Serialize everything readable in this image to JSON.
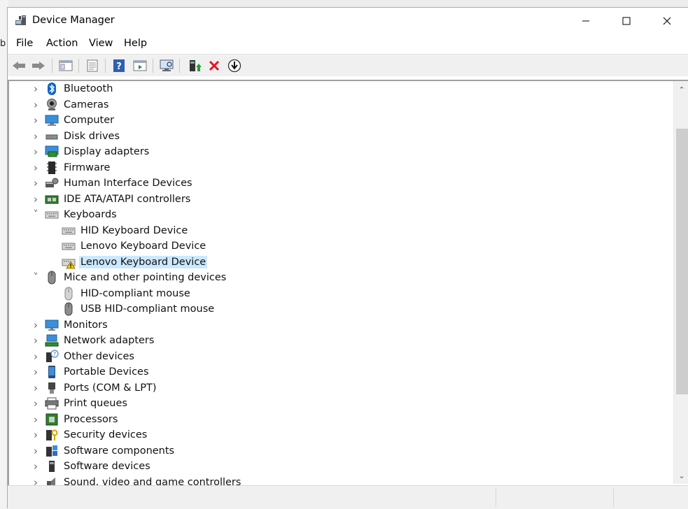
{
  "background": {
    "partial_text": "b"
  },
  "window": {
    "title": "Device Manager"
  },
  "menu": [
    "File",
    "Action",
    "View",
    "Help"
  ],
  "toolbar": [
    "back-arrow-icon",
    "forward-arrow-icon",
    "console-tree-icon",
    "properties-icon",
    "help-icon",
    "action-pane-icon",
    "scan-hardware-icon",
    "update-driver-icon",
    "uninstall-device-icon",
    "disable-device-icon"
  ],
  "tree": {
    "nodes": [
      {
        "label": "Bluetooth",
        "icon": "bluetooth-icon",
        "level": 0,
        "expander": "collapsed"
      },
      {
        "label": "Cameras",
        "icon": "camera-icon",
        "level": 0,
        "expander": "collapsed"
      },
      {
        "label": "Computer",
        "icon": "computer-icon",
        "level": 0,
        "expander": "collapsed"
      },
      {
        "label": "Disk drives",
        "icon": "disk-drive-icon",
        "level": 0,
        "expander": "collapsed"
      },
      {
        "label": "Display adapters",
        "icon": "display-adapter-icon",
        "level": 0,
        "expander": "collapsed"
      },
      {
        "label": "Firmware",
        "icon": "firmware-icon",
        "level": 0,
        "expander": "collapsed"
      },
      {
        "label": "Human Interface Devices",
        "icon": "hid-icon",
        "level": 0,
        "expander": "collapsed"
      },
      {
        "label": "IDE ATA/ATAPI controllers",
        "icon": "ide-controller-icon",
        "level": 0,
        "expander": "collapsed"
      },
      {
        "label": "Keyboards",
        "icon": "keyboard-icon",
        "level": 0,
        "expander": "expanded"
      },
      {
        "label": "HID Keyboard Device",
        "icon": "keyboard-icon",
        "level": 1,
        "expander": "none"
      },
      {
        "label": "Lenovo Keyboard Device",
        "icon": "keyboard-icon",
        "level": 1,
        "expander": "none"
      },
      {
        "label": "Lenovo Keyboard Device",
        "icon": "keyboard-warning-icon",
        "level": 1,
        "expander": "none",
        "selected": true
      },
      {
        "label": "Mice and other pointing devices",
        "icon": "mouse-icon",
        "level": 0,
        "expander": "expanded"
      },
      {
        "label": "HID-compliant mouse",
        "icon": "mouse-light-icon",
        "level": 1,
        "expander": "none"
      },
      {
        "label": "USB HID-compliant mouse",
        "icon": "mouse-icon",
        "level": 1,
        "expander": "none"
      },
      {
        "label": "Monitors",
        "icon": "monitor-icon",
        "level": 0,
        "expander": "collapsed"
      },
      {
        "label": "Network adapters",
        "icon": "network-adapter-icon",
        "level": 0,
        "expander": "collapsed"
      },
      {
        "label": "Other devices",
        "icon": "other-devices-icon",
        "level": 0,
        "expander": "collapsed"
      },
      {
        "label": "Portable Devices",
        "icon": "portable-device-icon",
        "level": 0,
        "expander": "collapsed"
      },
      {
        "label": "Ports (COM & LPT)",
        "icon": "port-icon",
        "level": 0,
        "expander": "collapsed"
      },
      {
        "label": "Print queues",
        "icon": "printer-icon",
        "level": 0,
        "expander": "collapsed"
      },
      {
        "label": "Processors",
        "icon": "processor-icon",
        "level": 0,
        "expander": "collapsed"
      },
      {
        "label": "Security devices",
        "icon": "security-device-icon",
        "level": 0,
        "expander": "collapsed"
      },
      {
        "label": "Software components",
        "icon": "software-component-icon",
        "level": 0,
        "expander": "collapsed"
      },
      {
        "label": "Software devices",
        "icon": "software-device-icon",
        "level": 0,
        "expander": "collapsed"
      },
      {
        "label": "Sound, video and game controllers",
        "icon": "sound-icon",
        "level": 0,
        "expander": "collapsed"
      }
    ]
  },
  "colors": {
    "selection": "#cce8ff",
    "accent": "#0078d7",
    "warning": "#f5c400",
    "uninstall": "#e81123"
  }
}
